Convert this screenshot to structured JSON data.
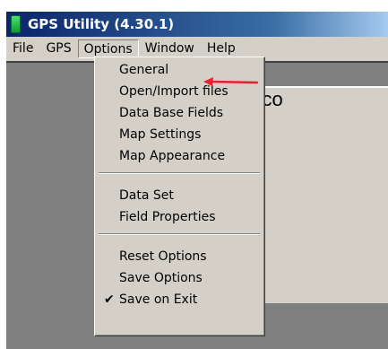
{
  "window": {
    "title": "GPS Utility (4.30.1)"
  },
  "menubar": [
    "File",
    "GPS",
    "Options",
    "Window",
    "Help"
  ],
  "options_menu": {
    "group1": [
      "General",
      "Open/Import files",
      "Data Base Fields",
      "Map Settings",
      "Map Appearance"
    ],
    "group2": [
      "Data Set",
      "Field Properties"
    ],
    "group3": [
      "Reset Options",
      "Save Options",
      "Save on Exit"
    ],
    "checked_item": "Save on Exit"
  },
  "content": {
    "welcome_text": "Welco"
  },
  "colors": {
    "annotation_arrow": "#e8212f",
    "titlebar": "#0a246a",
    "face": "#d4d0c8"
  }
}
